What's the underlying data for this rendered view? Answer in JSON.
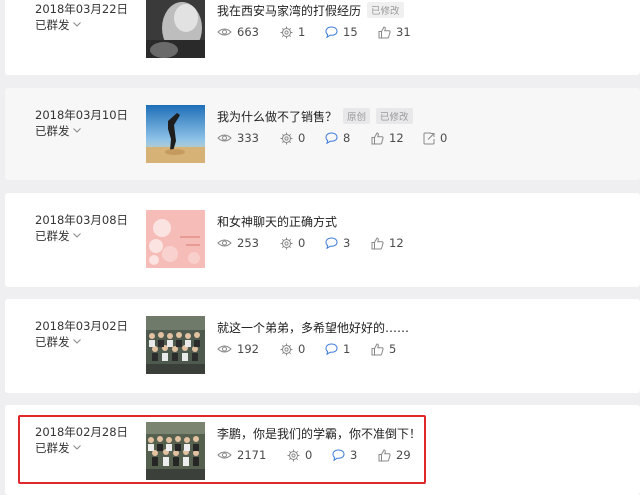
{
  "colors": {
    "highlight": "#e0282b",
    "icon": "#888888"
  },
  "articles": [
    {
      "date": "2018年03月22日",
      "status": "已群发",
      "title": "我在西安马家湾的打假经历",
      "tags": [
        "已修改"
      ],
      "stats": {
        "reads": "663",
        "likes": "1",
        "comments": "15",
        "thumbs": "31"
      }
    },
    {
      "date": "2018年03月10日",
      "status": "已群发",
      "title": "我为什么做不了销售？",
      "tags": [
        "原创",
        "已修改"
      ],
      "stats": {
        "reads": "333",
        "likes": "0",
        "comments": "8",
        "thumbs": "12",
        "shares": "0"
      }
    },
    {
      "date": "2018年03月08日",
      "status": "已群发",
      "title": "和女神聊天的正确方式",
      "tags": [],
      "stats": {
        "reads": "253",
        "likes": "0",
        "comments": "3",
        "thumbs": "12"
      }
    },
    {
      "date": "2018年03月02日",
      "status": "已群发",
      "title": "就这一个弟弟，多希望他好好的……",
      "tags": [],
      "stats": {
        "reads": "192",
        "likes": "0",
        "comments": "1",
        "thumbs": "5"
      }
    },
    {
      "date": "2018年02月28日",
      "status": "已群发",
      "title": "李鹏，你是我们的学霸，你不准倒下！",
      "tags": [],
      "stats": {
        "reads": "2171",
        "likes": "0",
        "comments": "3",
        "thumbs": "29"
      }
    }
  ]
}
